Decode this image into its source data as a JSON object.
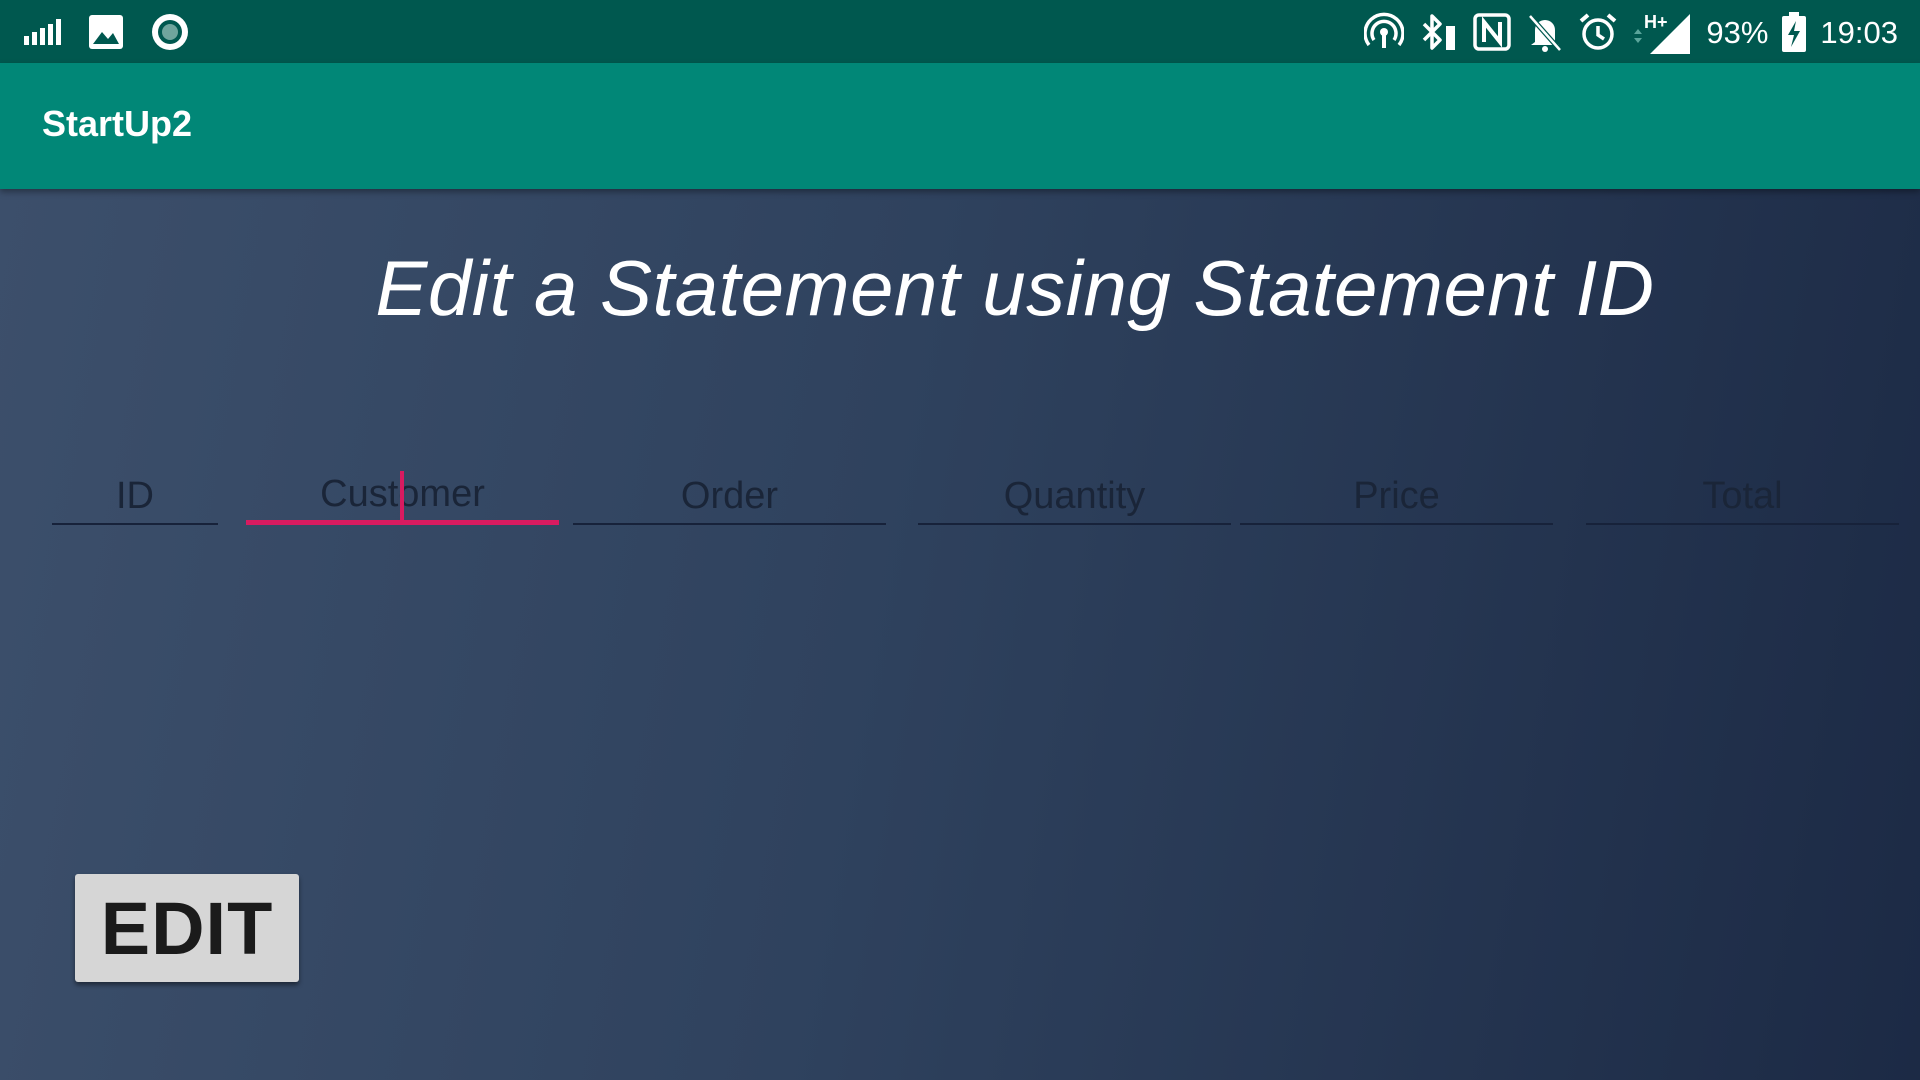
{
  "status_bar": {
    "left_icons": [
      "signal-bars-icon",
      "image-notification-icon",
      "record-notification-icon"
    ],
    "right_icons": [
      "hotspot-icon",
      "bluetooth-icon",
      "nfc-icon",
      "bell-off-icon",
      "alarm-clock-icon",
      "mobile-data-icon",
      "cell-signal-icon",
      "battery-charging-icon"
    ],
    "network_type": "H+",
    "battery": "93%",
    "time": "19:03"
  },
  "app_bar": {
    "title": "StartUp2"
  },
  "main": {
    "heading": "Edit a Statement using Statement ID",
    "fields": [
      {
        "name": "id",
        "placeholder": "ID",
        "value": ""
      },
      {
        "name": "customer",
        "placeholder": "Customer",
        "value": "",
        "focused": true
      },
      {
        "name": "order",
        "placeholder": "Order",
        "value": ""
      },
      {
        "name": "quantity",
        "placeholder": "Quantity",
        "value": ""
      },
      {
        "name": "price",
        "placeholder": "Price",
        "value": ""
      },
      {
        "name": "total",
        "placeholder": "Total",
        "value": ""
      }
    ],
    "edit_button_label": "EDIT"
  },
  "colors": {
    "status_bar": "#00584f",
    "app_bar": "#018777",
    "accent": "#d81b60",
    "background_start": "#3c4f6b",
    "background_end": "#1c2a45",
    "button": "#d6d6d6"
  }
}
